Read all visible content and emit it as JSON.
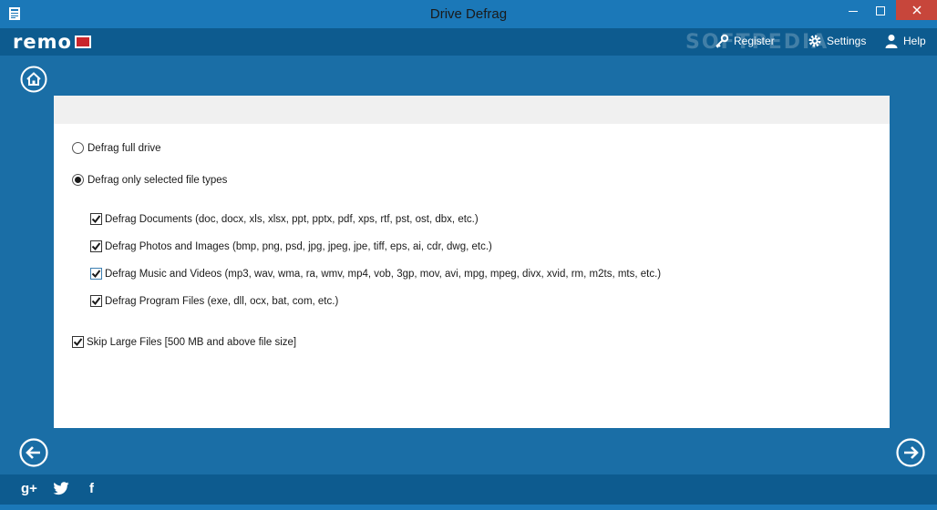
{
  "window": {
    "title": "Drive Defrag"
  },
  "header": {
    "logo": "remo",
    "watermark": "SOFTPEDIA",
    "register_label": "Register",
    "settings_label": "Settings",
    "help_label": "Help"
  },
  "options": {
    "defrag_full_drive": {
      "label": "Defrag full drive",
      "selected": false
    },
    "defrag_selected_types": {
      "label": "Defrag only selected file types",
      "selected": true
    },
    "file_types": [
      {
        "label": "Defrag Documents (doc, docx, xls, xlsx, ppt, pptx, pdf, xps, rtf, pst, ost, dbx, etc.)",
        "checked": true
      },
      {
        "label": "Defrag Photos and Images (bmp, png, psd, jpg, jpeg, jpe, tiff, eps, ai, cdr, dwg, etc.)",
        "checked": true
      },
      {
        "label": "Defrag Music and Videos (mp3, wav, wma, ra, wmv, mp4, vob, 3gp, mov, avi, mpg, mpeg, divx, xvid, rm, m2ts, mts, etc.)",
        "checked": true
      },
      {
        "label": "Defrag Program Files (exe, dll, ocx, bat, com, etc.)",
        "checked": true
      }
    ],
    "skip_large_files": {
      "label": "Skip Large Files [500 MB and above file size]",
      "checked": true
    }
  },
  "footer": {
    "gplus": "g+",
    "twitter": "twitter",
    "facebook": "f"
  },
  "colors": {
    "titlebar": "#1b78b8",
    "appbar": "#0d5b8f",
    "main_bg": "#1a6ea6",
    "close_button": "#c7463b",
    "logo_red": "#c9242b"
  }
}
